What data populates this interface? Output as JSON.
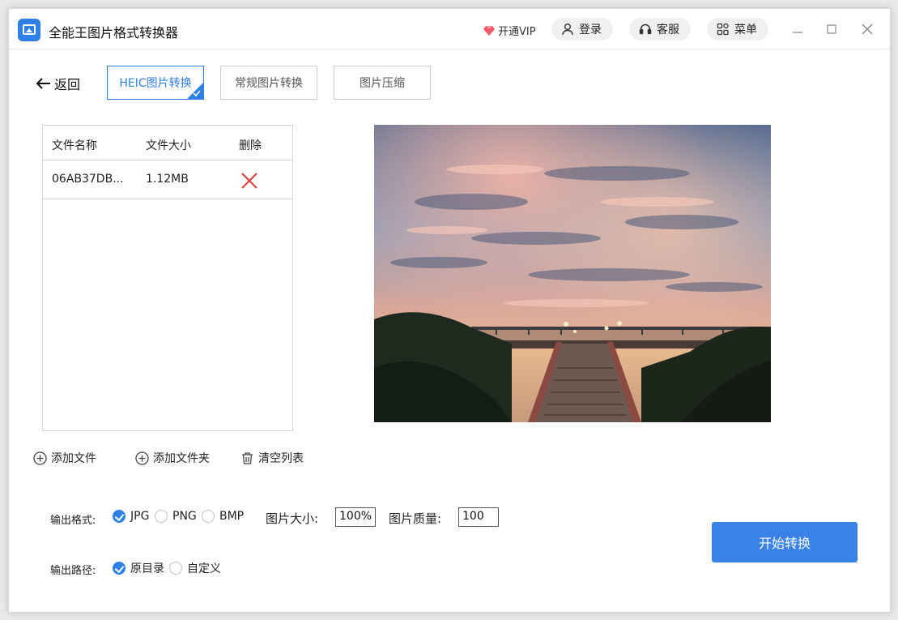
{
  "app": {
    "title": "全能王图片格式转换器"
  },
  "header": {
    "vip_label": "开通VIP",
    "login_label": "登录",
    "service_label": "客服",
    "menu_label": "菜单"
  },
  "nav": {
    "back_label": "返回",
    "tabs": [
      {
        "label": "HEIC图片转换",
        "active": true
      },
      {
        "label": "常规图片转换",
        "active": false
      },
      {
        "label": "图片压缩",
        "active": false
      }
    ]
  },
  "file_table": {
    "columns": [
      "文件名称",
      "文件大小",
      "删除"
    ],
    "rows": [
      {
        "name": "06AB37DB...",
        "size": "1.12MB"
      }
    ]
  },
  "actions": {
    "add_file": "添加文件",
    "add_folder": "添加文件夹",
    "clear_list": "清空列表"
  },
  "options": {
    "format_label": "输出格式:",
    "formats": [
      {
        "label": "JPG",
        "checked": true
      },
      {
        "label": "PNG",
        "checked": false
      },
      {
        "label": "BMP",
        "checked": false
      }
    ],
    "size_label": "图片大小:",
    "size_value": "100%",
    "quality_label": "图片质量:",
    "quality_value": "100",
    "path_label": "输出路径:",
    "paths": [
      {
        "label": "原目录",
        "checked": true
      },
      {
        "label": "自定义",
        "checked": false
      }
    ]
  },
  "start_button": "开始转换",
  "colors": {
    "accent": "#2e7fe8",
    "delete": "#e53935",
    "button": "#3b82e8"
  }
}
